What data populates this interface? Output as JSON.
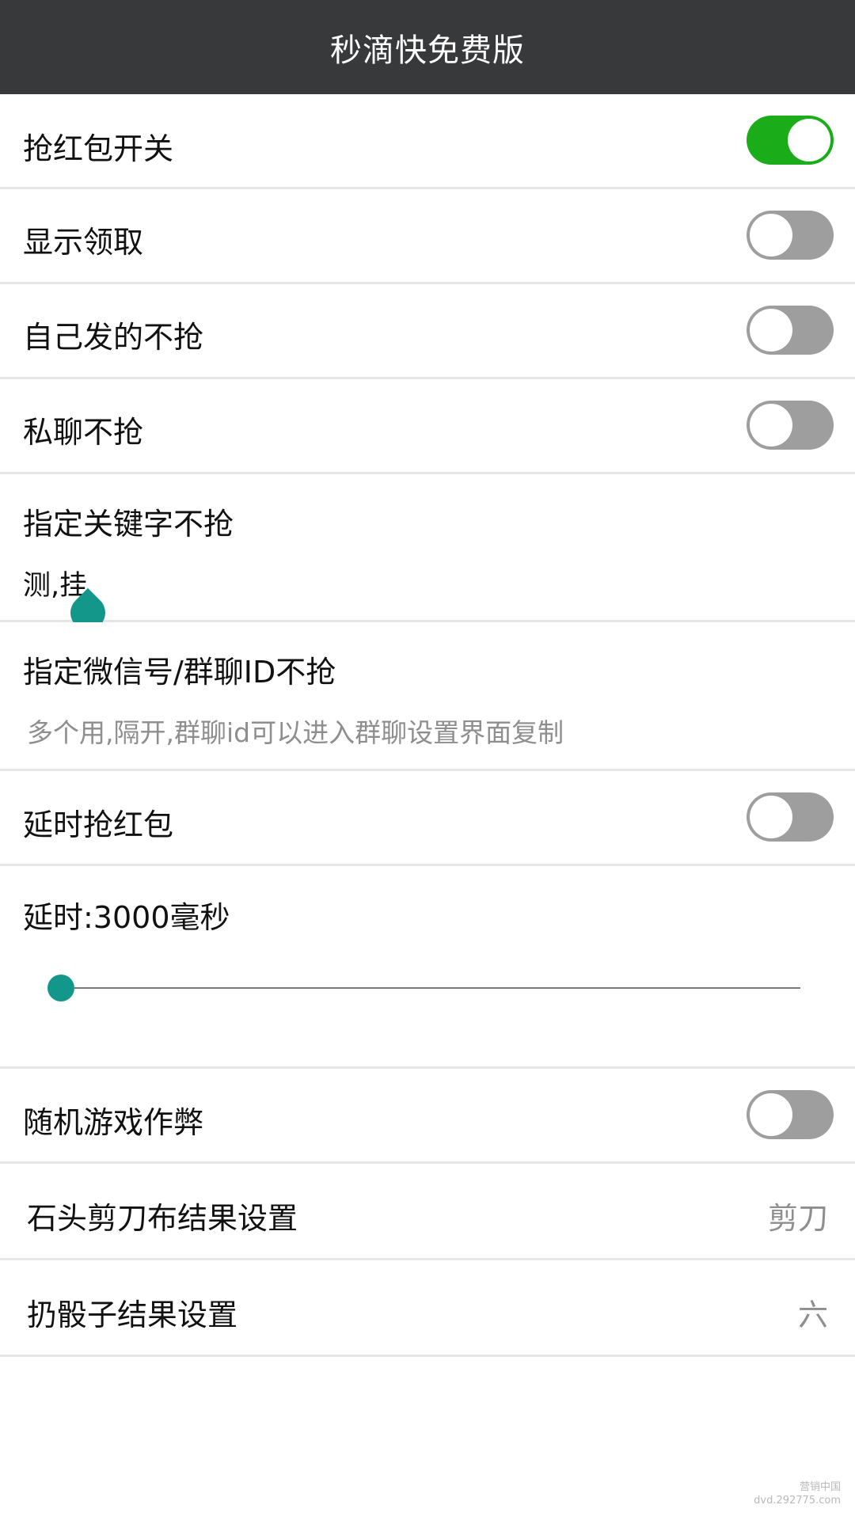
{
  "app": {
    "title": "秒滴快免费版"
  },
  "settings": {
    "grab_switch": {
      "label": "抢红包开关",
      "on": true
    },
    "show_claim": {
      "label": "显示领取",
      "on": false
    },
    "skip_own": {
      "label": "自己发的不抢",
      "on": false
    },
    "skip_private": {
      "label": "私聊不抢",
      "on": false
    },
    "skip_keywords": {
      "label": "指定关键字不抢",
      "value": "测,挂"
    },
    "skip_ids": {
      "label": "指定微信号/群聊ID不抢",
      "placeholder": "多个用,隔开,群聊id可以进入群聊设置界面复制"
    },
    "delay_grab": {
      "label": "延时抢红包",
      "on": false
    },
    "delay_value": {
      "label": "延时:3000毫秒",
      "fraction": 0.0
    },
    "game_cheat": {
      "label": "随机游戏作弊",
      "on": false
    },
    "rps_result": {
      "label": "石头剪刀布结果设置",
      "value": "剪刀"
    },
    "dice_result": {
      "label": "扔骰子结果设置",
      "value": "六"
    }
  },
  "colors": {
    "titlebar": "#38393b",
    "toggle_on": "#1aad19",
    "toggle_off": "#9e9e9e",
    "accent": "#14978b"
  },
  "watermark": {
    "line1": "营销中国",
    "line2": "dvd.292775.com"
  }
}
